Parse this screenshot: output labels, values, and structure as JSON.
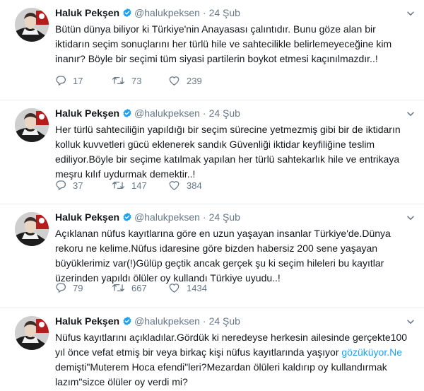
{
  "tweets": [
    {
      "name": "Haluk Pekşen",
      "handle": "@halukpeksen",
      "dot": "·",
      "date": "24 Şub",
      "text": "Bütün dünya biliyor ki Türkiye'nin Anayasası çalıntıdır. Bunu göze alan bir iktidarın seçim sonuçlarını her türlü hile ve sahtecilikle belirlemeyeceğine kim inanır? Böyle bir seçimi tüm siyasi partilerin boykot etmesi kaçınılmazdır..!",
      "replies": "17",
      "retweets": "73",
      "likes": "239"
    },
    {
      "name": "Haluk Pekşen",
      "handle": "@halukpeksen",
      "dot": "·",
      "date": "24 Şub",
      "text": "Her türlü sahteciliğin yapıldığı bir seçim sürecine yetmezmiş gibi bir de iktidarın kolluk kuvvetleri gücü eklenerek sandık Güvenliği iktidar keyfiliğine teslim ediliyor.Böyle bir seçime katılmak yapılan her türlü sahtekarlık hile ve entrikaya meşru kılıf uydurmak demektir..!",
      "replies": "37",
      "retweets": "147",
      "likes": "384"
    },
    {
      "name": "Haluk Pekşen",
      "handle": "@halukpeksen",
      "dot": "·",
      "date": "24 Şub",
      "text": "Açıklanan nüfus kayıtlarına göre en uzun yaşayan insanlar Türkiye'de.Dünya rekoru ne kelime.Nüfus idaresine göre bizden habersiz 200 sene yaşayan büyüklerimiz var(!)Gülüp geçtik ancak gerçek şu ki seçim hileleri bu kayıtlar üzerinden yapıldı ölüler oy kullandı Türkiye uyudu..!",
      "replies": "79",
      "retweets": "667",
      "likes": "1434"
    },
    {
      "name": "Haluk Pekşen",
      "handle": "@halukpeksen",
      "dot": "·",
      "date": "24 Şub",
      "text_before": "Nüfus kayıtlarını açıkladılar.Gördük ki neredeyse herkesin ailesinde gerçekte100 yıl önce vefat etmiş bir veya birkaç kişi nüfus kayıtlarında yaşıyor ",
      "link": "gözüküyor.Ne",
      "text_after": " demişti\"Muterem Hoca efendi\"leri?Mezardan ölüleri kaldırıp oy kullandırmak lazım\"sizce ölüler oy verdi mi?"
    }
  ],
  "icons": {
    "verified": "verified-badge-icon",
    "caret": "chevron-down-icon",
    "reply": "reply-icon",
    "retweet": "retweet-icon",
    "like": "heart-icon"
  },
  "colors": {
    "text": "#14171a",
    "muted": "#657786",
    "accent": "#1da1f2",
    "divider": "#e6ecf0"
  }
}
